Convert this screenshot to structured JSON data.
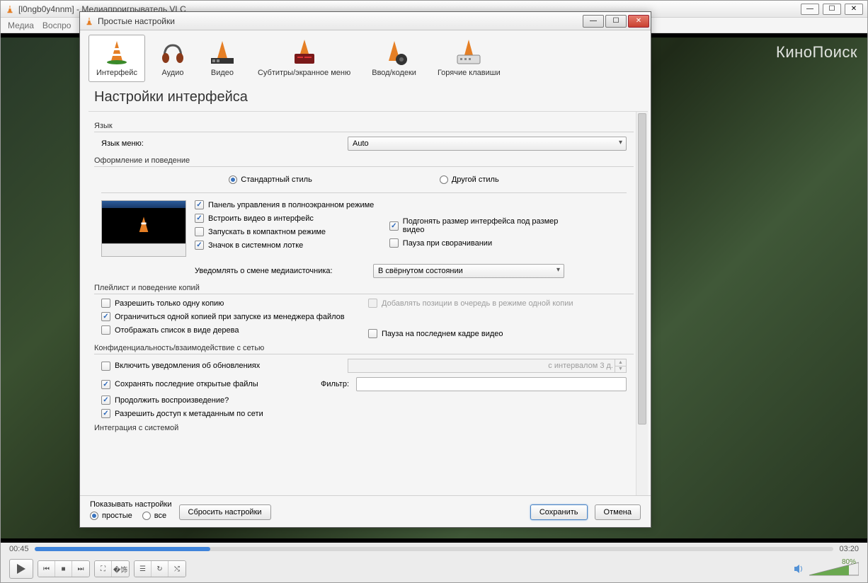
{
  "main_window": {
    "title": "[l0ngb0y4nnm] - Медиапроигрыватель VLC",
    "menu": {
      "media": "Медиа",
      "playback": "Воспро"
    },
    "overlay": "КиноПоиск",
    "time_current": "00:45",
    "time_total": "03:20",
    "volume_pct": "80%"
  },
  "modal": {
    "title": "Простые настройки",
    "tabs": {
      "interface": "Интерфейс",
      "audio": "Аудио",
      "video": "Видео",
      "subtitles": "Субтитры/экранное меню",
      "input": "Ввод/кодеки",
      "hotkeys": "Горячие клавиши"
    },
    "heading": "Настройки интерфейса",
    "lang": {
      "section": "Язык",
      "menu_label": "Язык меню:",
      "value": "Auto"
    },
    "look": {
      "section": "Оформление и поведение",
      "style_native": "Стандартный стиль",
      "style_custom": "Другой стиль",
      "cb_fscontrols": "Панель управления в полноэкранном режиме",
      "cb_embed": "Встроить видео в интерфейс",
      "cb_resize": "Подгонять размер интерфейса под размер видео",
      "cb_minimal": "Запускать в компактном режиме",
      "cb_pausemin": "Пауза при сворачивании",
      "cb_tray": "Значок в системном лотке",
      "notify_label": "Уведомлять о смене медиаисточника:",
      "notify_value": "В свёрнутом состоянии"
    },
    "playlist": {
      "section": "Плейлист и поведение копий",
      "cb_oneinstance": "Разрешить только одну копию",
      "cb_enqueue": "Добавлять позиции в очередь в режиме одной копии",
      "cb_limitfm": "Ограничиться одной копией при запуске из менеджера файлов",
      "cb_tree": "Отображать список в виде дерева",
      "cb_lastframe": "Пауза на последнем кадре видео"
    },
    "privacy": {
      "section": "Конфиденциальность/взаимодействие с сетью",
      "cb_updates": "Включить уведомления об обновлениях",
      "interval": "с интервалом 3 д.",
      "cb_recent": "Сохранять последние открытые файлы",
      "filter_label": "Фильтр:",
      "cb_resume": "Продолжить воспроизведение?",
      "cb_metadata": "Разрешить доступ к метаданным по сети"
    },
    "sys": {
      "section": "Интеграция с системой"
    },
    "footer": {
      "show_label": "Показывать настройки",
      "simple": "простые",
      "all": "все",
      "reset": "Сбросить настройки",
      "save": "Сохранить",
      "cancel": "Отмена"
    }
  }
}
